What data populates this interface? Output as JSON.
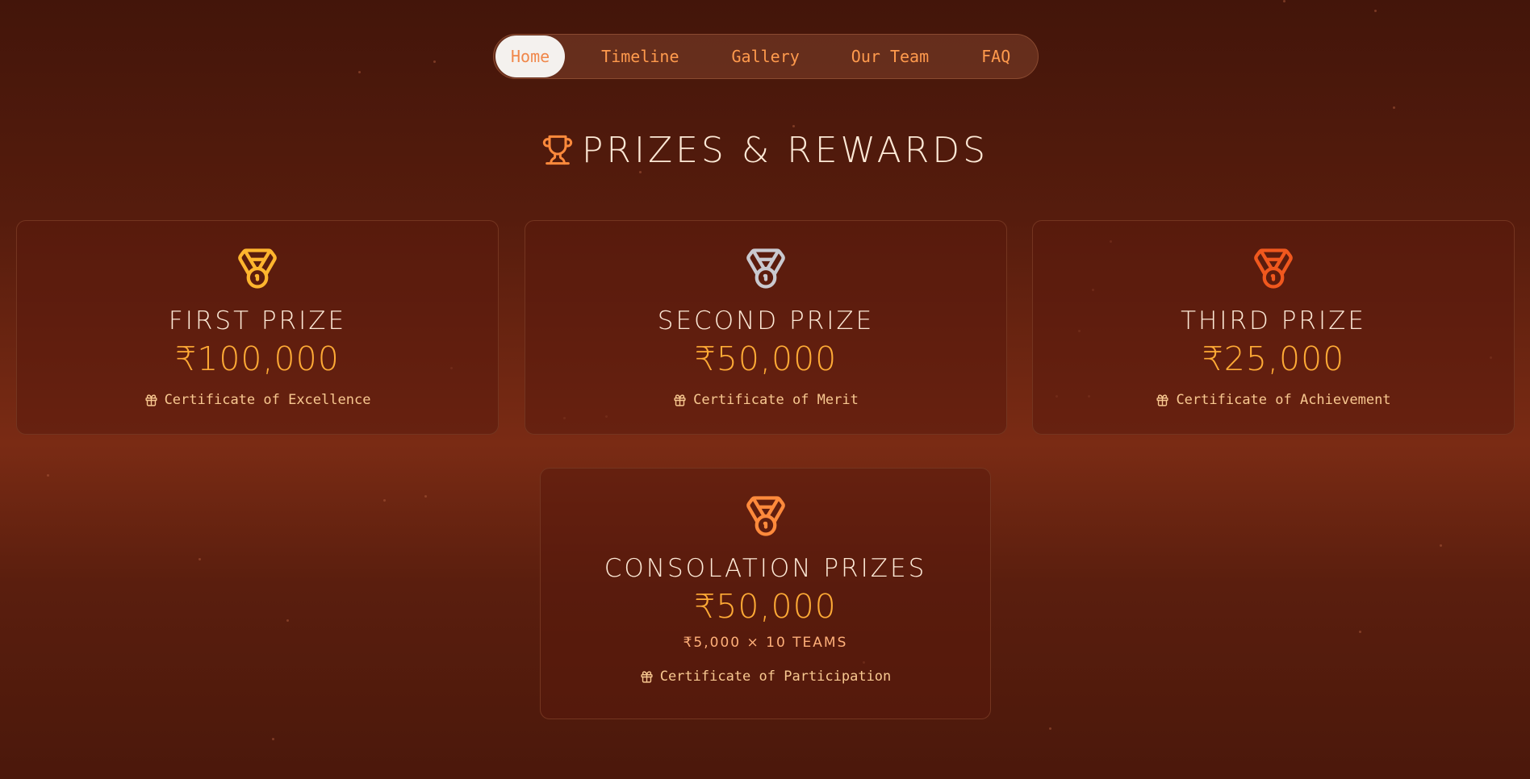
{
  "nav": {
    "items": [
      {
        "label": "Home",
        "active": true
      },
      {
        "label": "Timeline"
      },
      {
        "label": "Gallery"
      },
      {
        "label": "Our Team"
      },
      {
        "label": "FAQ"
      }
    ]
  },
  "section": {
    "title": "Prizes & Rewards",
    "icon": "trophy-icon"
  },
  "prizes": [
    {
      "title": "First Prize",
      "amount": "₹100,000",
      "certificate": "Certificate of Excellence",
      "medal_color": "#ffb52e",
      "icon": "medal-icon"
    },
    {
      "title": "Second Prize",
      "amount": "₹50,000",
      "certificate": "Certificate of Merit",
      "medal_color": "#c9c9cf",
      "icon": "medal-icon"
    },
    {
      "title": "Third Prize",
      "amount": "₹25,000",
      "certificate": "Certificate of Achievement",
      "medal_color": "#f0581e",
      "icon": "medal-icon"
    },
    {
      "title": "Consolation Prizes",
      "amount": "₹50,000",
      "subtitle": "₹5,000 × 10 Teams",
      "certificate": "Certificate of Participation",
      "medal_color": "#ff8a3c",
      "icon": "medal-icon"
    }
  ],
  "colors": {
    "accent": "#ff9a4d",
    "amount": "#ffab36",
    "title": "#fde9d6",
    "certificate_text": "#f8c890",
    "gift_icon": "#f8c890"
  }
}
